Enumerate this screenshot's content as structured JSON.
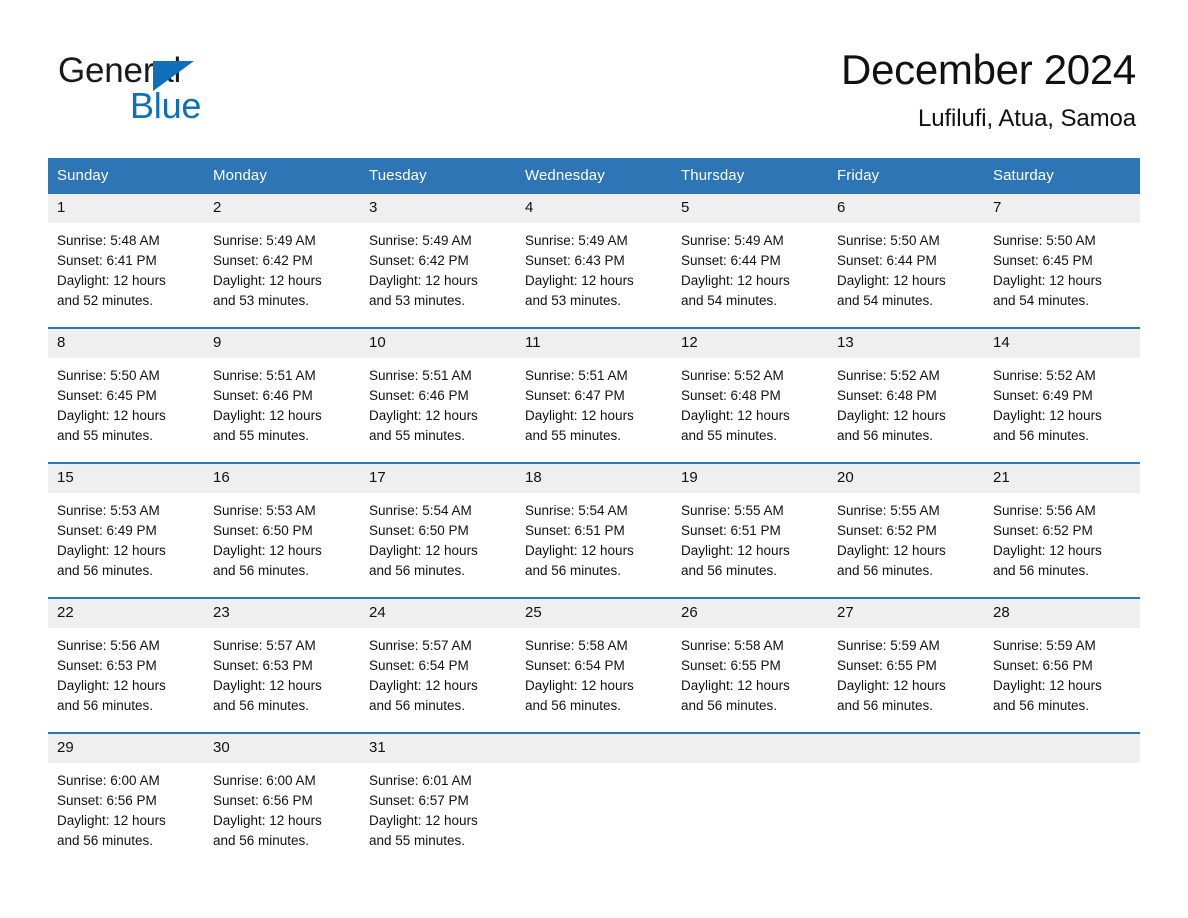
{
  "brand": {
    "name_part1": "General",
    "name_part2": "Blue",
    "logo_triangle": "triangle-icon",
    "accent_blue": "#0f6fb8"
  },
  "header": {
    "title": "December 2024",
    "subtitle": "Lufilufi, Atua, Samoa",
    "header_bar_color": "#2e75b6",
    "date_band_color": "#efefef"
  },
  "weekdays": [
    "Sunday",
    "Monday",
    "Tuesday",
    "Wednesday",
    "Thursday",
    "Friday",
    "Saturday"
  ],
  "weeks": [
    [
      {
        "day": "1",
        "sunrise": "Sunrise: 5:48 AM",
        "sunset": "Sunset: 6:41 PM",
        "daylight_line1": "Daylight: 12 hours",
        "daylight_line2": "and 52 minutes."
      },
      {
        "day": "2",
        "sunrise": "Sunrise: 5:49 AM",
        "sunset": "Sunset: 6:42 PM",
        "daylight_line1": "Daylight: 12 hours",
        "daylight_line2": "and 53 minutes."
      },
      {
        "day": "3",
        "sunrise": "Sunrise: 5:49 AM",
        "sunset": "Sunset: 6:42 PM",
        "daylight_line1": "Daylight: 12 hours",
        "daylight_line2": "and 53 minutes."
      },
      {
        "day": "4",
        "sunrise": "Sunrise: 5:49 AM",
        "sunset": "Sunset: 6:43 PM",
        "daylight_line1": "Daylight: 12 hours",
        "daylight_line2": "and 53 minutes."
      },
      {
        "day": "5",
        "sunrise": "Sunrise: 5:49 AM",
        "sunset": "Sunset: 6:44 PM",
        "daylight_line1": "Daylight: 12 hours",
        "daylight_line2": "and 54 minutes."
      },
      {
        "day": "6",
        "sunrise": "Sunrise: 5:50 AM",
        "sunset": "Sunset: 6:44 PM",
        "daylight_line1": "Daylight: 12 hours",
        "daylight_line2": "and 54 minutes."
      },
      {
        "day": "7",
        "sunrise": "Sunrise: 5:50 AM",
        "sunset": "Sunset: 6:45 PM",
        "daylight_line1": "Daylight: 12 hours",
        "daylight_line2": "and 54 minutes."
      }
    ],
    [
      {
        "day": "8",
        "sunrise": "Sunrise: 5:50 AM",
        "sunset": "Sunset: 6:45 PM",
        "daylight_line1": "Daylight: 12 hours",
        "daylight_line2": "and 55 minutes."
      },
      {
        "day": "9",
        "sunrise": "Sunrise: 5:51 AM",
        "sunset": "Sunset: 6:46 PM",
        "daylight_line1": "Daylight: 12 hours",
        "daylight_line2": "and 55 minutes."
      },
      {
        "day": "10",
        "sunrise": "Sunrise: 5:51 AM",
        "sunset": "Sunset: 6:46 PM",
        "daylight_line1": "Daylight: 12 hours",
        "daylight_line2": "and 55 minutes."
      },
      {
        "day": "11",
        "sunrise": "Sunrise: 5:51 AM",
        "sunset": "Sunset: 6:47 PM",
        "daylight_line1": "Daylight: 12 hours",
        "daylight_line2": "and 55 minutes."
      },
      {
        "day": "12",
        "sunrise": "Sunrise: 5:52 AM",
        "sunset": "Sunset: 6:48 PM",
        "daylight_line1": "Daylight: 12 hours",
        "daylight_line2": "and 55 minutes."
      },
      {
        "day": "13",
        "sunrise": "Sunrise: 5:52 AM",
        "sunset": "Sunset: 6:48 PM",
        "daylight_line1": "Daylight: 12 hours",
        "daylight_line2": "and 56 minutes."
      },
      {
        "day": "14",
        "sunrise": "Sunrise: 5:52 AM",
        "sunset": "Sunset: 6:49 PM",
        "daylight_line1": "Daylight: 12 hours",
        "daylight_line2": "and 56 minutes."
      }
    ],
    [
      {
        "day": "15",
        "sunrise": "Sunrise: 5:53 AM",
        "sunset": "Sunset: 6:49 PM",
        "daylight_line1": "Daylight: 12 hours",
        "daylight_line2": "and 56 minutes."
      },
      {
        "day": "16",
        "sunrise": "Sunrise: 5:53 AM",
        "sunset": "Sunset: 6:50 PM",
        "daylight_line1": "Daylight: 12 hours",
        "daylight_line2": "and 56 minutes."
      },
      {
        "day": "17",
        "sunrise": "Sunrise: 5:54 AM",
        "sunset": "Sunset: 6:50 PM",
        "daylight_line1": "Daylight: 12 hours",
        "daylight_line2": "and 56 minutes."
      },
      {
        "day": "18",
        "sunrise": "Sunrise: 5:54 AM",
        "sunset": "Sunset: 6:51 PM",
        "daylight_line1": "Daylight: 12 hours",
        "daylight_line2": "and 56 minutes."
      },
      {
        "day": "19",
        "sunrise": "Sunrise: 5:55 AM",
        "sunset": "Sunset: 6:51 PM",
        "daylight_line1": "Daylight: 12 hours",
        "daylight_line2": "and 56 minutes."
      },
      {
        "day": "20",
        "sunrise": "Sunrise: 5:55 AM",
        "sunset": "Sunset: 6:52 PM",
        "daylight_line1": "Daylight: 12 hours",
        "daylight_line2": "and 56 minutes."
      },
      {
        "day": "21",
        "sunrise": "Sunrise: 5:56 AM",
        "sunset": "Sunset: 6:52 PM",
        "daylight_line1": "Daylight: 12 hours",
        "daylight_line2": "and 56 minutes."
      }
    ],
    [
      {
        "day": "22",
        "sunrise": "Sunrise: 5:56 AM",
        "sunset": "Sunset: 6:53 PM",
        "daylight_line1": "Daylight: 12 hours",
        "daylight_line2": "and 56 minutes."
      },
      {
        "day": "23",
        "sunrise": "Sunrise: 5:57 AM",
        "sunset": "Sunset: 6:53 PM",
        "daylight_line1": "Daylight: 12 hours",
        "daylight_line2": "and 56 minutes."
      },
      {
        "day": "24",
        "sunrise": "Sunrise: 5:57 AM",
        "sunset": "Sunset: 6:54 PM",
        "daylight_line1": "Daylight: 12 hours",
        "daylight_line2": "and 56 minutes."
      },
      {
        "day": "25",
        "sunrise": "Sunrise: 5:58 AM",
        "sunset": "Sunset: 6:54 PM",
        "daylight_line1": "Daylight: 12 hours",
        "daylight_line2": "and 56 minutes."
      },
      {
        "day": "26",
        "sunrise": "Sunrise: 5:58 AM",
        "sunset": "Sunset: 6:55 PM",
        "daylight_line1": "Daylight: 12 hours",
        "daylight_line2": "and 56 minutes."
      },
      {
        "day": "27",
        "sunrise": "Sunrise: 5:59 AM",
        "sunset": "Sunset: 6:55 PM",
        "daylight_line1": "Daylight: 12 hours",
        "daylight_line2": "and 56 minutes."
      },
      {
        "day": "28",
        "sunrise": "Sunrise: 5:59 AM",
        "sunset": "Sunset: 6:56 PM",
        "daylight_line1": "Daylight: 12 hours",
        "daylight_line2": "and 56 minutes."
      }
    ],
    [
      {
        "day": "29",
        "sunrise": "Sunrise: 6:00 AM",
        "sunset": "Sunset: 6:56 PM",
        "daylight_line1": "Daylight: 12 hours",
        "daylight_line2": "and 56 minutes."
      },
      {
        "day": "30",
        "sunrise": "Sunrise: 6:00 AM",
        "sunset": "Sunset: 6:56 PM",
        "daylight_line1": "Daylight: 12 hours",
        "daylight_line2": "and 56 minutes."
      },
      {
        "day": "31",
        "sunrise": "Sunrise: 6:01 AM",
        "sunset": "Sunset: 6:57 PM",
        "daylight_line1": "Daylight: 12 hours",
        "daylight_line2": "and 55 minutes."
      },
      {
        "day": "",
        "sunrise": "",
        "sunset": "",
        "daylight_line1": "",
        "daylight_line2": ""
      },
      {
        "day": "",
        "sunrise": "",
        "sunset": "",
        "daylight_line1": "",
        "daylight_line2": ""
      },
      {
        "day": "",
        "sunrise": "",
        "sunset": "",
        "daylight_line1": "",
        "daylight_line2": ""
      },
      {
        "day": "",
        "sunrise": "",
        "sunset": "",
        "daylight_line1": "",
        "daylight_line2": ""
      }
    ]
  ]
}
